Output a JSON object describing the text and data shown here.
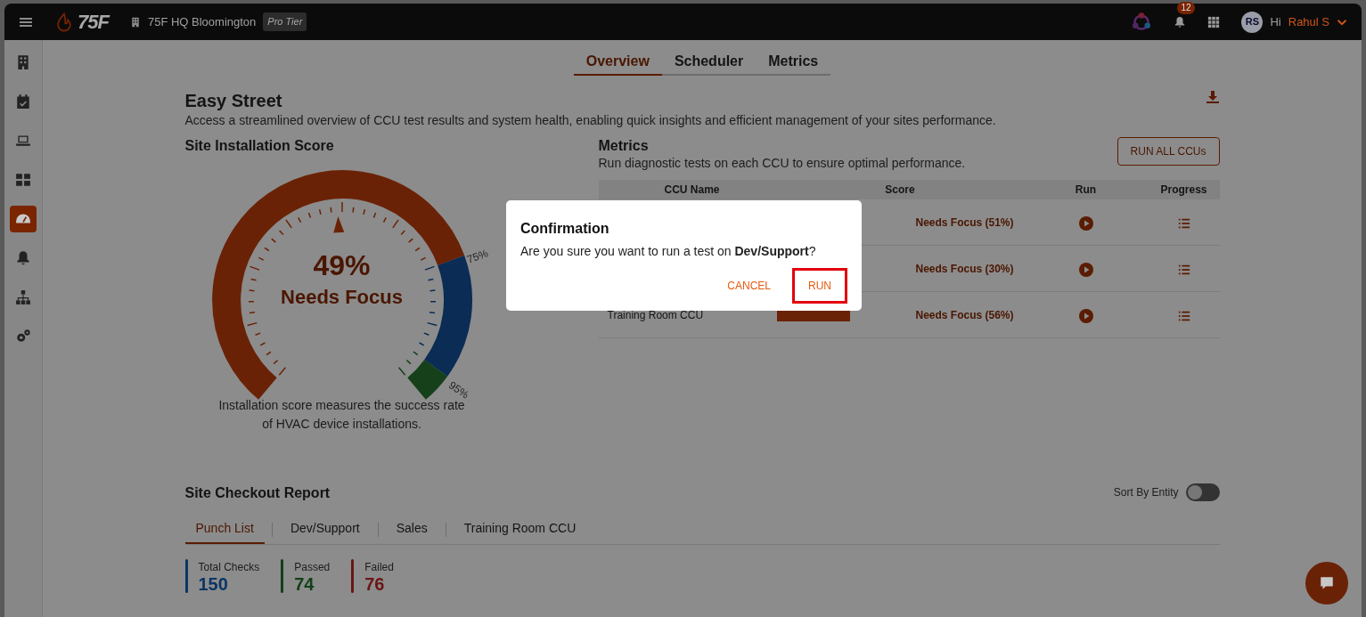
{
  "header": {
    "brand": "75F",
    "site": "75F HQ Bloomington",
    "tier": "Pro Tier",
    "notification_count": "12",
    "avatar": "RS",
    "greeting": "Hi",
    "user": "Rahul S"
  },
  "sidebar": {
    "items": [
      {
        "kind": "building",
        "selected": false
      },
      {
        "kind": "calendar",
        "selected": false
      },
      {
        "kind": "laptop",
        "selected": false
      },
      {
        "kind": "dashboard",
        "selected": false
      },
      {
        "kind": "gauge",
        "selected": true
      },
      {
        "kind": "bell",
        "selected": false
      },
      {
        "kind": "hierarchy",
        "selected": false
      },
      {
        "kind": "gears",
        "selected": false
      }
    ]
  },
  "tabs": [
    {
      "label": "Overview",
      "selected": true
    },
    {
      "label": "Scheduler",
      "selected": false
    },
    {
      "label": "Metrics",
      "selected": false
    }
  ],
  "page": {
    "title": "Easy Street",
    "description": "Access a streamlined overview of CCU test results and system health, enabling quick insights and efficient management of your sites performance."
  },
  "installation_score": {
    "title": "Site Installation Score",
    "level": 0.49,
    "value": "49%",
    "status": "Needs Focus",
    "markers": [
      "75%",
      "95%"
    ],
    "caption": "Installation score measures the success rate of HVAC device installations."
  },
  "metrics": {
    "title": "Metrics",
    "subtitle": "Run diagnostic tests on each CCU to ensure optimal performance.",
    "run_all_button": "RUN ALL CCUs",
    "columns": [
      "CCU Name",
      "Score",
      "Run",
      "Progress"
    ],
    "rows": [
      {
        "score": "Needs Focus (51%)"
      },
      {
        "score": "Needs Focus (30%)"
      },
      {
        "name": "Training Room CCU",
        "score": "Needs Focus (56%)"
      }
    ]
  },
  "checkout_report": {
    "title": "Site Checkout Report",
    "sort_label": "Sort By Entity",
    "sort_on": false,
    "tabs": [
      {
        "label": "Punch List",
        "selected": true
      },
      {
        "label": "Dev/Support",
        "selected": false
      },
      {
        "label": "Sales",
        "selected": false
      },
      {
        "label": "Training Room CCU",
        "selected": false
      }
    ],
    "stats": [
      {
        "label": "Total Checks",
        "value": "150",
        "color": "#0b3566"
      },
      {
        "label": "Passed",
        "value": "74",
        "color": "#124016"
      },
      {
        "label": "Failed",
        "value": "76",
        "color": "#6b1515"
      }
    ]
  },
  "dialog": {
    "title": "Confirmation",
    "message": "Are you sure you want to run a test on **Dev/Support**?",
    "buttons": [
      {
        "label": "CANCEL",
        "highlighted": false
      },
      {
        "label": "RUN",
        "highlighted": true
      }
    ]
  }
}
